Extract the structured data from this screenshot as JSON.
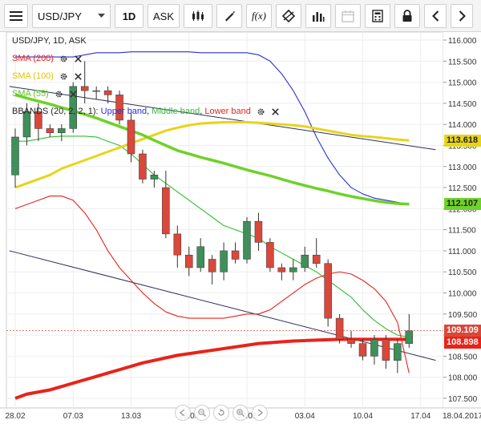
{
  "toolbar": {
    "symbol": "USD/JPY",
    "interval": "1D",
    "price_type": "ASK",
    "fx_label": "f(x)",
    "icons": [
      "menu-icon",
      "candle-type-icon",
      "draw-icon",
      "indicator-icon",
      "crosshair-icon",
      "volume-icon",
      "calendar-icon",
      "calculator-icon",
      "lock-icon",
      "prev-icon",
      "next-icon"
    ]
  },
  "legend": {
    "title": "USD/JPY, 1D, ASK",
    "sma200": "SMA (200)",
    "sma100": "SMA (100)",
    "sma55": "SMA (55)",
    "bbands_prefix": "BBANDS (20, 2, 2, 1):",
    "bbands_upper": "Upper band",
    "bbands_middle": "Middle band",
    "bbands_lower": "Lower band",
    "sep": ","
  },
  "price_tags": {
    "sma100": "113.618",
    "sma55": "112.107",
    "last": "109.109",
    "sma200": "108.898"
  },
  "colors": {
    "up": "#3f8f5a",
    "down": "#d9483b",
    "sma200": "#e8231a",
    "sma100": "#e8d41a",
    "sma55": "#6fd12a",
    "bb_upper": "#2a2fd6",
    "bb_middle": "#2fbf2f",
    "bb_lower": "#e8231a",
    "trendline": "#2b2f5a",
    "last_price": "#d9483b",
    "sma200_tag": "#e8231a"
  },
  "chart_data": {
    "type": "candlestick",
    "ylim": [
      107.5,
      116.0
    ],
    "y_ticks": [
      "116.000",
      "115.500",
      "115.000",
      "114.500",
      "114.000",
      "113.500",
      "113.000",
      "112.500",
      "112.000",
      "111.500",
      "111.000",
      "110.500",
      "110.000",
      "109.500",
      "109.000",
      "108.500",
      "108.000",
      "107.500"
    ],
    "x_tick_labels": [
      {
        "label": "28.02",
        "i": 0
      },
      {
        "label": "07.03",
        "i": 5
      },
      {
        "label": "13.03",
        "i": 10
      },
      {
        "label": "20.03",
        "i": 15
      },
      {
        "label": "27.03",
        "i": 20
      },
      {
        "label": "03.04",
        "i": 25
      },
      {
        "label": "10.04",
        "i": 30
      },
      {
        "label": "17.04",
        "i": 35
      },
      {
        "label": "18.04.2017",
        "i": 36
      }
    ],
    "candles": [
      {
        "o": 112.8,
        "h": 113.9,
        "l": 112.5,
        "c": 113.7
      },
      {
        "o": 113.7,
        "h": 114.5,
        "l": 113.5,
        "c": 114.3
      },
      {
        "o": 114.3,
        "h": 114.5,
        "l": 113.6,
        "c": 113.9
      },
      {
        "o": 113.9,
        "h": 114.0,
        "l": 113.7,
        "c": 113.8
      },
      {
        "o": 113.8,
        "h": 114.0,
        "l": 113.6,
        "c": 113.9
      },
      {
        "o": 113.9,
        "h": 115.0,
        "l": 113.8,
        "c": 114.9
      },
      {
        "o": 114.9,
        "h": 115.5,
        "l": 114.5,
        "c": 114.8
      },
      {
        "o": 114.8,
        "h": 114.9,
        "l": 114.6,
        "c": 114.8
      },
      {
        "o": 114.8,
        "h": 114.9,
        "l": 114.5,
        "c": 114.7
      },
      {
        "o": 114.7,
        "h": 114.8,
        "l": 114.0,
        "c": 114.1
      },
      {
        "o": 114.1,
        "h": 114.3,
        "l": 113.1,
        "c": 113.3
      },
      {
        "o": 113.3,
        "h": 113.4,
        "l": 112.6,
        "c": 112.7
      },
      {
        "o": 112.7,
        "h": 112.9,
        "l": 112.5,
        "c": 112.8
      },
      {
        "o": 112.5,
        "h": 112.9,
        "l": 111.3,
        "c": 111.4
      },
      {
        "o": 111.4,
        "h": 111.6,
        "l": 110.6,
        "c": 110.9
      },
      {
        "o": 110.9,
        "h": 111.1,
        "l": 110.4,
        "c": 110.6
      },
      {
        "o": 110.6,
        "h": 111.3,
        "l": 110.5,
        "c": 111.1
      },
      {
        "o": 110.8,
        "h": 110.9,
        "l": 110.2,
        "c": 110.5
      },
      {
        "o": 110.5,
        "h": 111.2,
        "l": 110.3,
        "c": 111.0
      },
      {
        "o": 111.0,
        "h": 111.2,
        "l": 110.7,
        "c": 110.8
      },
      {
        "o": 110.8,
        "h": 111.8,
        "l": 110.7,
        "c": 111.7
      },
      {
        "o": 111.7,
        "h": 111.9,
        "l": 111.0,
        "c": 111.2
      },
      {
        "o": 111.2,
        "h": 111.3,
        "l": 110.5,
        "c": 110.6
      },
      {
        "o": 110.6,
        "h": 110.7,
        "l": 110.3,
        "c": 110.5
      },
      {
        "o": 110.5,
        "h": 110.8,
        "l": 110.3,
        "c": 110.6
      },
      {
        "o": 110.6,
        "h": 111.1,
        "l": 110.5,
        "c": 110.9
      },
      {
        "o": 110.9,
        "h": 111.3,
        "l": 110.6,
        "c": 110.7
      },
      {
        "o": 110.7,
        "h": 110.8,
        "l": 109.2,
        "c": 109.4
      },
      {
        "o": 109.4,
        "h": 109.5,
        "l": 108.8,
        "c": 108.9
      },
      {
        "o": 108.9,
        "h": 109.1,
        "l": 108.7,
        "c": 108.8
      },
      {
        "o": 108.8,
        "h": 108.9,
        "l": 108.4,
        "c": 108.5
      },
      {
        "o": 108.5,
        "h": 109.0,
        "l": 108.3,
        "c": 108.9
      },
      {
        "o": 108.9,
        "h": 109.0,
        "l": 108.2,
        "c": 108.4
      },
      {
        "o": 108.4,
        "h": 108.9,
        "l": 108.1,
        "c": 108.8
      },
      {
        "o": 108.8,
        "h": 109.5,
        "l": 108.7,
        "c": 109.1
      }
    ],
    "sma200": [
      107.5,
      107.6,
      107.65,
      107.7,
      107.78,
      107.86,
      107.94,
      108.02,
      108.1,
      108.18,
      108.26,
      108.34,
      108.4,
      108.46,
      108.52,
      108.56,
      108.6,
      108.64,
      108.68,
      108.72,
      108.76,
      108.8,
      108.82,
      108.84,
      108.86,
      108.87,
      108.88,
      108.89,
      108.9,
      108.9,
      108.9,
      108.9,
      108.9,
      108.9,
      108.898
    ],
    "sma100": [
      112.5,
      112.6,
      112.7,
      112.8,
      112.95,
      113.05,
      113.15,
      113.25,
      113.35,
      113.45,
      113.55,
      113.65,
      113.75,
      113.85,
      113.92,
      113.98,
      114.02,
      114.04,
      114.05,
      114.05,
      114.05,
      114.04,
      114.02,
      114.0,
      113.98,
      113.95,
      113.9,
      113.85,
      113.8,
      113.75,
      113.72,
      113.7,
      113.67,
      113.64,
      113.618
    ],
    "sma55": [
      114.7,
      114.62,
      114.55,
      114.48,
      114.4,
      114.32,
      114.24,
      114.15,
      114.05,
      113.95,
      113.85,
      113.75,
      113.62,
      113.5,
      113.38,
      113.3,
      113.22,
      113.15,
      113.08,
      113.0,
      112.92,
      112.85,
      112.78,
      112.7,
      112.62,
      112.55,
      112.48,
      112.42,
      112.35,
      112.29,
      112.24,
      112.19,
      112.15,
      112.12,
      112.107
    ],
    "bb_upper": [
      115.6,
      115.6,
      115.6,
      115.6,
      115.6,
      115.6,
      115.65,
      115.7,
      115.7,
      115.7,
      115.72,
      115.72,
      115.72,
      115.72,
      115.72,
      115.72,
      115.7,
      115.7,
      115.7,
      115.7,
      115.7,
      115.65,
      115.5,
      115.2,
      114.8,
      114.3,
      113.7,
      113.2,
      112.8,
      112.5,
      112.35,
      112.25,
      112.2,
      112.15,
      112.1
    ],
    "bb_middle": [
      113.6,
      113.6,
      113.65,
      113.7,
      113.72,
      113.72,
      113.72,
      113.7,
      113.6,
      113.5,
      113.3,
      113.05,
      112.8,
      112.6,
      112.4,
      112.2,
      112.0,
      111.8,
      111.6,
      111.5,
      111.4,
      111.3,
      111.1,
      110.95,
      110.8,
      110.65,
      110.5,
      110.3,
      110.1,
      109.9,
      109.6,
      109.35,
      109.15,
      109.0,
      108.95
    ],
    "bb_lower": [
      112.0,
      112.1,
      112.2,
      112.3,
      112.3,
      112.2,
      111.9,
      111.5,
      111.0,
      110.6,
      110.3,
      110.0,
      109.75,
      109.55,
      109.45,
      109.4,
      109.4,
      109.4,
      109.4,
      109.45,
      109.5,
      109.5,
      109.6,
      109.8,
      110.0,
      110.2,
      110.35,
      110.45,
      110.5,
      110.45,
      110.3,
      110.1,
      109.8,
      109.3,
      108.1
    ],
    "trendlines": [
      {
        "from": {
          "i": -0.5,
          "y": 114.9
        },
        "to": {
          "i": 36.3,
          "y": 113.4
        }
      },
      {
        "from": {
          "i": -0.5,
          "y": 111.0
        },
        "to": {
          "i": 36.3,
          "y": 108.4
        }
      }
    ],
    "last_price": 109.109
  }
}
